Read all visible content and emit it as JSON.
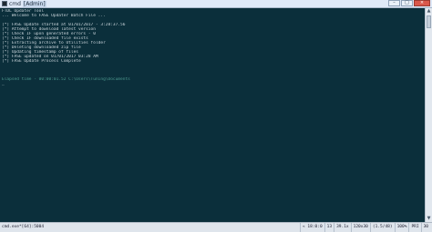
{
  "window": {
    "title_prefix": "cmd",
    "title_highlight": "[Admin]",
    "controls": [
      "–",
      "□",
      "×"
    ]
  },
  "console": {
    "lines": [
      "FTDL Updater Tool",
      "... Welcome to FASE Updater Batch File ...",
      "",
      "[*] FASE Update started at 01/01/2017 - 3:28:37.56",
      "[*] Attempt to download latest version",
      "[*] Check IF upon generated errors - 0",
      "[*] Check IF downloaded file exists",
      "[*] Extracting archive to Utilities folder",
      "[*] Deleting downloaded zip file",
      "[*] Updating timestamp of files",
      "[*] FASE updated on 01/01/2017 03:28 AM",
      "[*] FASE Update Process Complete"
    ],
    "prompt": "Elapsed time - 00:00:01.52 C:\\Users\\Tuning\\Documents",
    "cursor": "_"
  },
  "statusbar": {
    "left": "cmd.exe*[64]:5004",
    "segments": [
      "« 18:0:0",
      "13",
      "39.1x",
      "120x30",
      "(1.5/48)",
      "100%",
      "PRI",
      "30"
    ]
  }
}
